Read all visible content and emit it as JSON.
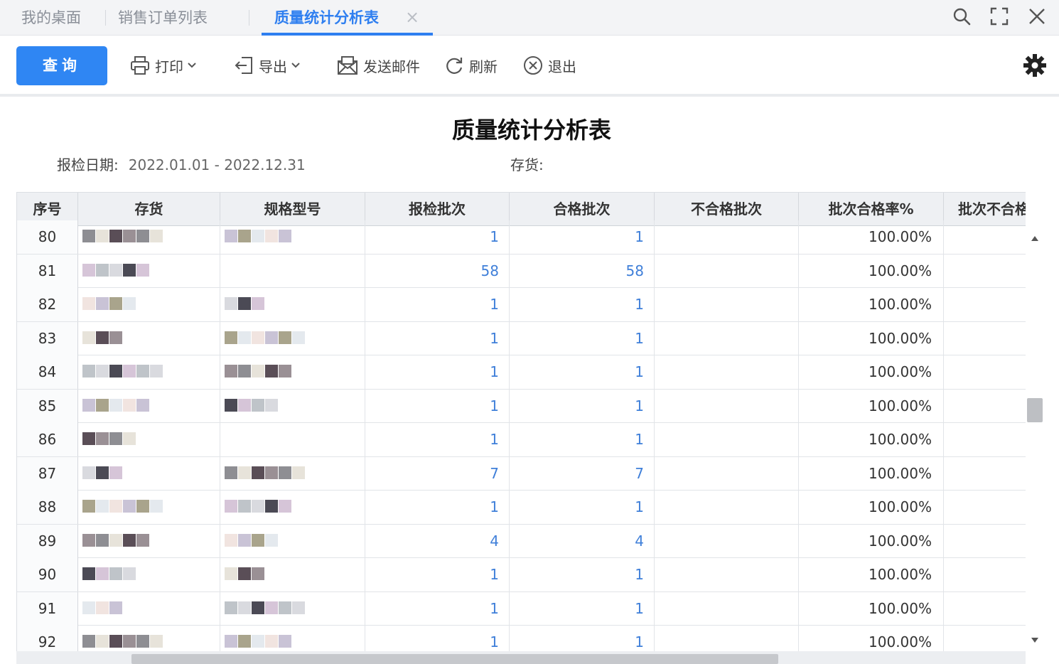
{
  "tabs": [
    {
      "label": "我的桌面",
      "active": false
    },
    {
      "label": "销售订单列表",
      "active": false
    },
    {
      "label": "质量统计分析表",
      "active": true
    }
  ],
  "window_icons": [
    "search-icon",
    "fullscreen-icon",
    "close-icon"
  ],
  "toolbar": {
    "query_label": "查询",
    "print_label": "打印",
    "export_label": "导出",
    "send_mail_label": "发送邮件",
    "refresh_label": "刷新",
    "exit_label": "退出",
    "settings_icon": "gear-icon"
  },
  "colors": {
    "accent": "#2f86f3",
    "link_number": "#3f7fd9"
  },
  "report": {
    "title": "质量统计分析表",
    "date_label": "报检日期:",
    "date_value": "2022.01.01 - 2022.12.31",
    "inventory_label": "存货:",
    "inventory_value": ""
  },
  "table": {
    "columns": [
      "序号",
      "存货",
      "规格型号",
      "报检批次",
      "合格批次",
      "不合格批次",
      "批次合格率%",
      "批次不合格"
    ],
    "rows": [
      {
        "seq": "80",
        "inspect": "1",
        "pass": "1",
        "fail": "",
        "rate": "100.00%"
      },
      {
        "seq": "81",
        "inspect": "58",
        "pass": "58",
        "fail": "",
        "rate": "100.00%"
      },
      {
        "seq": "82",
        "inspect": "1",
        "pass": "1",
        "fail": "",
        "rate": "100.00%"
      },
      {
        "seq": "83",
        "inspect": "1",
        "pass": "1",
        "fail": "",
        "rate": "100.00%"
      },
      {
        "seq": "84",
        "inspect": "1",
        "pass": "1",
        "fail": "",
        "rate": "100.00%"
      },
      {
        "seq": "85",
        "inspect": "1",
        "pass": "1",
        "fail": "",
        "rate": "100.00%"
      },
      {
        "seq": "86",
        "inspect": "1",
        "pass": "1",
        "fail": "",
        "rate": "100.00%"
      },
      {
        "seq": "87",
        "inspect": "7",
        "pass": "7",
        "fail": "",
        "rate": "100.00%"
      },
      {
        "seq": "88",
        "inspect": "1",
        "pass": "1",
        "fail": "",
        "rate": "100.00%"
      },
      {
        "seq": "89",
        "inspect": "4",
        "pass": "4",
        "fail": "",
        "rate": "100.00%"
      },
      {
        "seq": "90",
        "inspect": "1",
        "pass": "1",
        "fail": "",
        "rate": "100.00%"
      },
      {
        "seq": "91",
        "inspect": "1",
        "pass": "1",
        "fail": "",
        "rate": "100.00%"
      },
      {
        "seq": "92",
        "inspect": "1",
        "pass": "1",
        "fail": "",
        "rate": "100.00%"
      }
    ]
  }
}
